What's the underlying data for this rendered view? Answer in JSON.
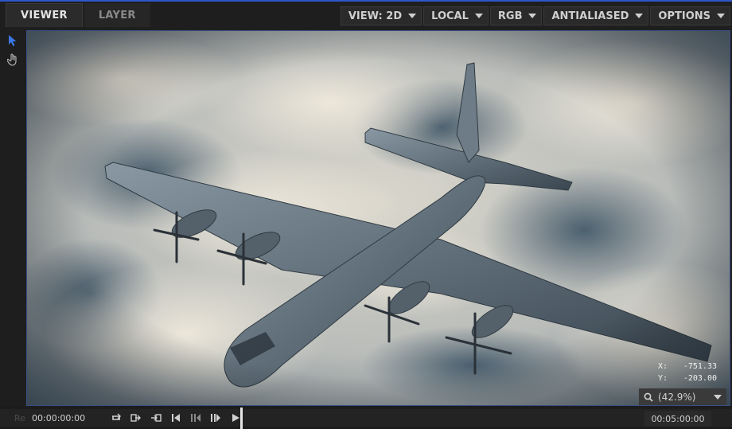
{
  "tabs": [
    {
      "label": "VIEWER",
      "active": true
    },
    {
      "label": "LAYER",
      "active": false
    }
  ],
  "toolbar": {
    "view": "VIEW: 2D",
    "space": "LOCAL",
    "channel": "RGB",
    "filter": "ANTIALIASED",
    "options": "OPTIONS"
  },
  "tools": [
    "arrow-select-icon",
    "hand-pan-icon"
  ],
  "viewer": {
    "coords": {
      "x_label": "X:",
      "x_value": "-751.33",
      "y_label": "Y:",
      "y_value": "-203.00"
    },
    "zoom": "(42.9%)"
  },
  "timeline": {
    "faded_label": "Re",
    "start_time": "00:00:00:00",
    "end_time": "00:05:00:00"
  },
  "colors": {
    "accent": "#2f56c9",
    "viewer_border": "#3a4f86",
    "cursor_blue": "#3b78e7"
  }
}
